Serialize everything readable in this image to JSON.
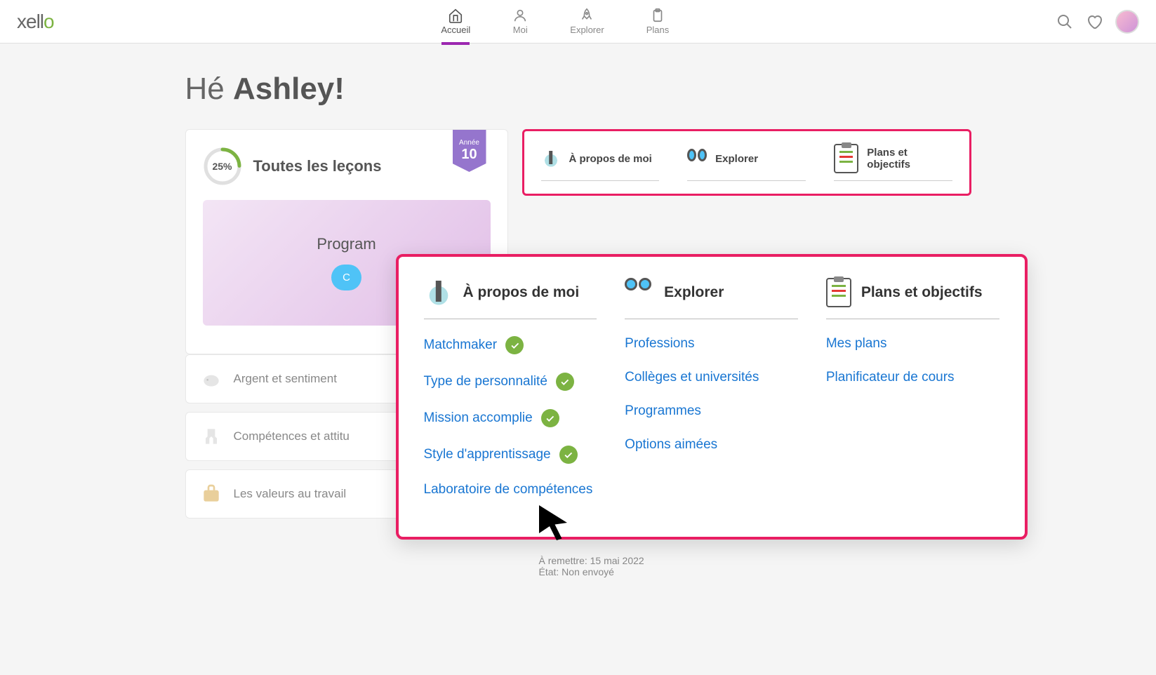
{
  "header": {
    "logo_text": "xell",
    "logo_accent": "o",
    "nav": [
      {
        "label": "Accueil",
        "icon": "home",
        "active": true
      },
      {
        "label": "Moi",
        "icon": "person",
        "active": false
      },
      {
        "label": "Explorer",
        "icon": "rocket",
        "active": false
      },
      {
        "label": "Plans",
        "icon": "clipboard",
        "active": false
      }
    ]
  },
  "greeting": {
    "prefix": "Hé ",
    "name": "Ashley!"
  },
  "lessons": {
    "progress_percent": "25%",
    "title": "Toutes les leçons",
    "year_label": "Année",
    "year_num": "10",
    "program_title": "Program",
    "program_btn": "C",
    "items": [
      {
        "label": "Argent et sentiment"
      },
      {
        "label": "Compétences et attitu"
      },
      {
        "label": "Les valeurs au travail"
      }
    ]
  },
  "quick_tabs": [
    {
      "label": "À propos de moi",
      "icon": "tower"
    },
    {
      "label": "Explorer",
      "icon": "binoculars"
    },
    {
      "label": "Plans et objectifs",
      "icon": "clipboard"
    }
  ],
  "overlay": {
    "cols": [
      {
        "title": "À propos de moi",
        "icon": "tower",
        "links": [
          {
            "label": "Matchmaker",
            "checked": true
          },
          {
            "label": "Type de personnalité",
            "checked": true
          },
          {
            "label": "Mission accomplie",
            "checked": true
          },
          {
            "label": "Style d'apprentissage",
            "checked": true
          },
          {
            "label": "Laboratoire de compétences",
            "checked": false
          }
        ]
      },
      {
        "title": "Explorer",
        "icon": "binoculars",
        "links": [
          {
            "label": "Professions",
            "checked": false
          },
          {
            "label": "Collèges et universités",
            "checked": false
          },
          {
            "label": "Programmes",
            "checked": false
          },
          {
            "label": "Options aimées",
            "checked": false
          }
        ]
      },
      {
        "title": "Plans et objectifs",
        "icon": "clipboard",
        "links": [
          {
            "label": "Mes plans",
            "checked": false
          },
          {
            "label": "Planificateur de cours",
            "checked": false
          }
        ]
      }
    ]
  },
  "due": {
    "line1": "À remettre: 15 mai 2022",
    "line2": "État: Non envoyé"
  }
}
